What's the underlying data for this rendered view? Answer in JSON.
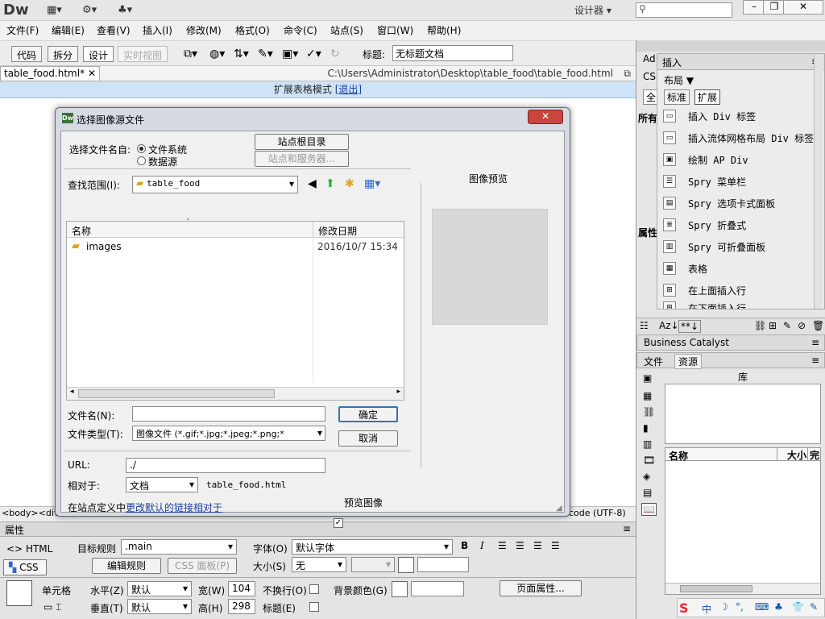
{
  "app": {
    "logo": "Dw",
    "workspace": "设计器",
    "search_placeholder": "",
    "window_buttons": [
      "–",
      "❐",
      "✕"
    ]
  },
  "menu": [
    "文件(F)",
    "编辑(E)",
    "查看(V)",
    "插入(I)",
    "修改(M)",
    "格式(O)",
    "命令(C)",
    "站点(S)",
    "窗口(W)",
    "帮助(H)"
  ],
  "toolbar": {
    "view_buttons": [
      "代码",
      "拆分",
      "设计",
      "实时视图"
    ],
    "title_label": "标题:",
    "title_value": "无标题文档"
  },
  "document": {
    "tab_name": "table_food.html*",
    "tab_close": "✕",
    "path": "C:\\Users\\Administrator\\Desktop\\table_food\\table_food.html",
    "ext_mode_text": "扩展表格模式",
    "ext_exit": "[退出]"
  },
  "status": {
    "tags": "<body><div",
    "encoding": "code (UTF-8)"
  },
  "dialog": {
    "title": "选择图像源文件",
    "close": "✕",
    "select_from_label": "选择文件名自:",
    "radio_filesystem": "文件系统",
    "radio_datasource": "数据源",
    "btn_site_root": "站点根目录",
    "btn_site_servers": "站点和服务器...",
    "lookin_label": "查找范围(I):",
    "lookin_value": "table_food",
    "col_name": "名称",
    "col_modified": "修改日期",
    "files": [
      {
        "name": "images",
        "modified": "2016/10/7 15:34"
      }
    ],
    "filename_label": "文件名(N):",
    "filename_value": "",
    "filetype_label": "文件类型(T):",
    "filetype_value": "图像文件 (*.gif;*.jpg;*.jpeg;*.png;*",
    "ok": "确定",
    "cancel": "取消",
    "preview_title": "图像预览",
    "url_label": "URL:",
    "url_value": "./",
    "relative_label": "相对于:",
    "relative_value": "文档",
    "relative_file": "table_food.html",
    "site_def_text": "在站点定义中",
    "site_def_link": "更改默认的链接相对于",
    "preview_check": "预览图像"
  },
  "insert_panel": {
    "tab_ad": "Ad",
    "tab_insert": "插入",
    "tab_css": "CS",
    "category": "布局",
    "mode_standard": "标准",
    "mode_expand": "扩展",
    "items": [
      "插入 Div 标签",
      "插入流体网格布局 Div 标签",
      "绘制 AP Div",
      "Spry 菜单栏",
      "Spry 选项卡式面板",
      "Spry 折叠式",
      "Spry 可折叠面板",
      "表格",
      "在上面插入行",
      "在下面插入行"
    ],
    "side_all": "全",
    "side_props": "所有",
    "side_attr": "属性"
  },
  "bc_panel": {
    "title": "Business Catalyst"
  },
  "assets_panel": {
    "tab_files": "文件",
    "tab_assets": "资源",
    "library_title": "库",
    "col_name": "名称",
    "col_size": "大小",
    "col_full": "完"
  },
  "properties": {
    "title": "属性",
    "html_btn": "HTML",
    "css_btn": "CSS",
    "target_rule_label": "目标规则",
    "target_rule_value": ".main",
    "edit_rule": "编辑规则",
    "css_panel": "CSS 面板(P)",
    "font_label": "字体(O)",
    "font_value": "默认字体",
    "size_label": "大小(S)",
    "size_value": "无",
    "cell_label": "单元格",
    "horiz_label": "水平(Z)",
    "horiz_value": "默认",
    "vert_label": "垂直(T)",
    "vert_value": "默认",
    "width_label": "宽(W)",
    "width_value": "104",
    "height_label": "高(H)",
    "height_value": "298",
    "nowrap_label": "不换行(O)",
    "header_label": "标题(E)",
    "bgcolor_label": "背景颜色(G)",
    "page_props": "页面属性..."
  },
  "ime": {
    "label": "中"
  }
}
